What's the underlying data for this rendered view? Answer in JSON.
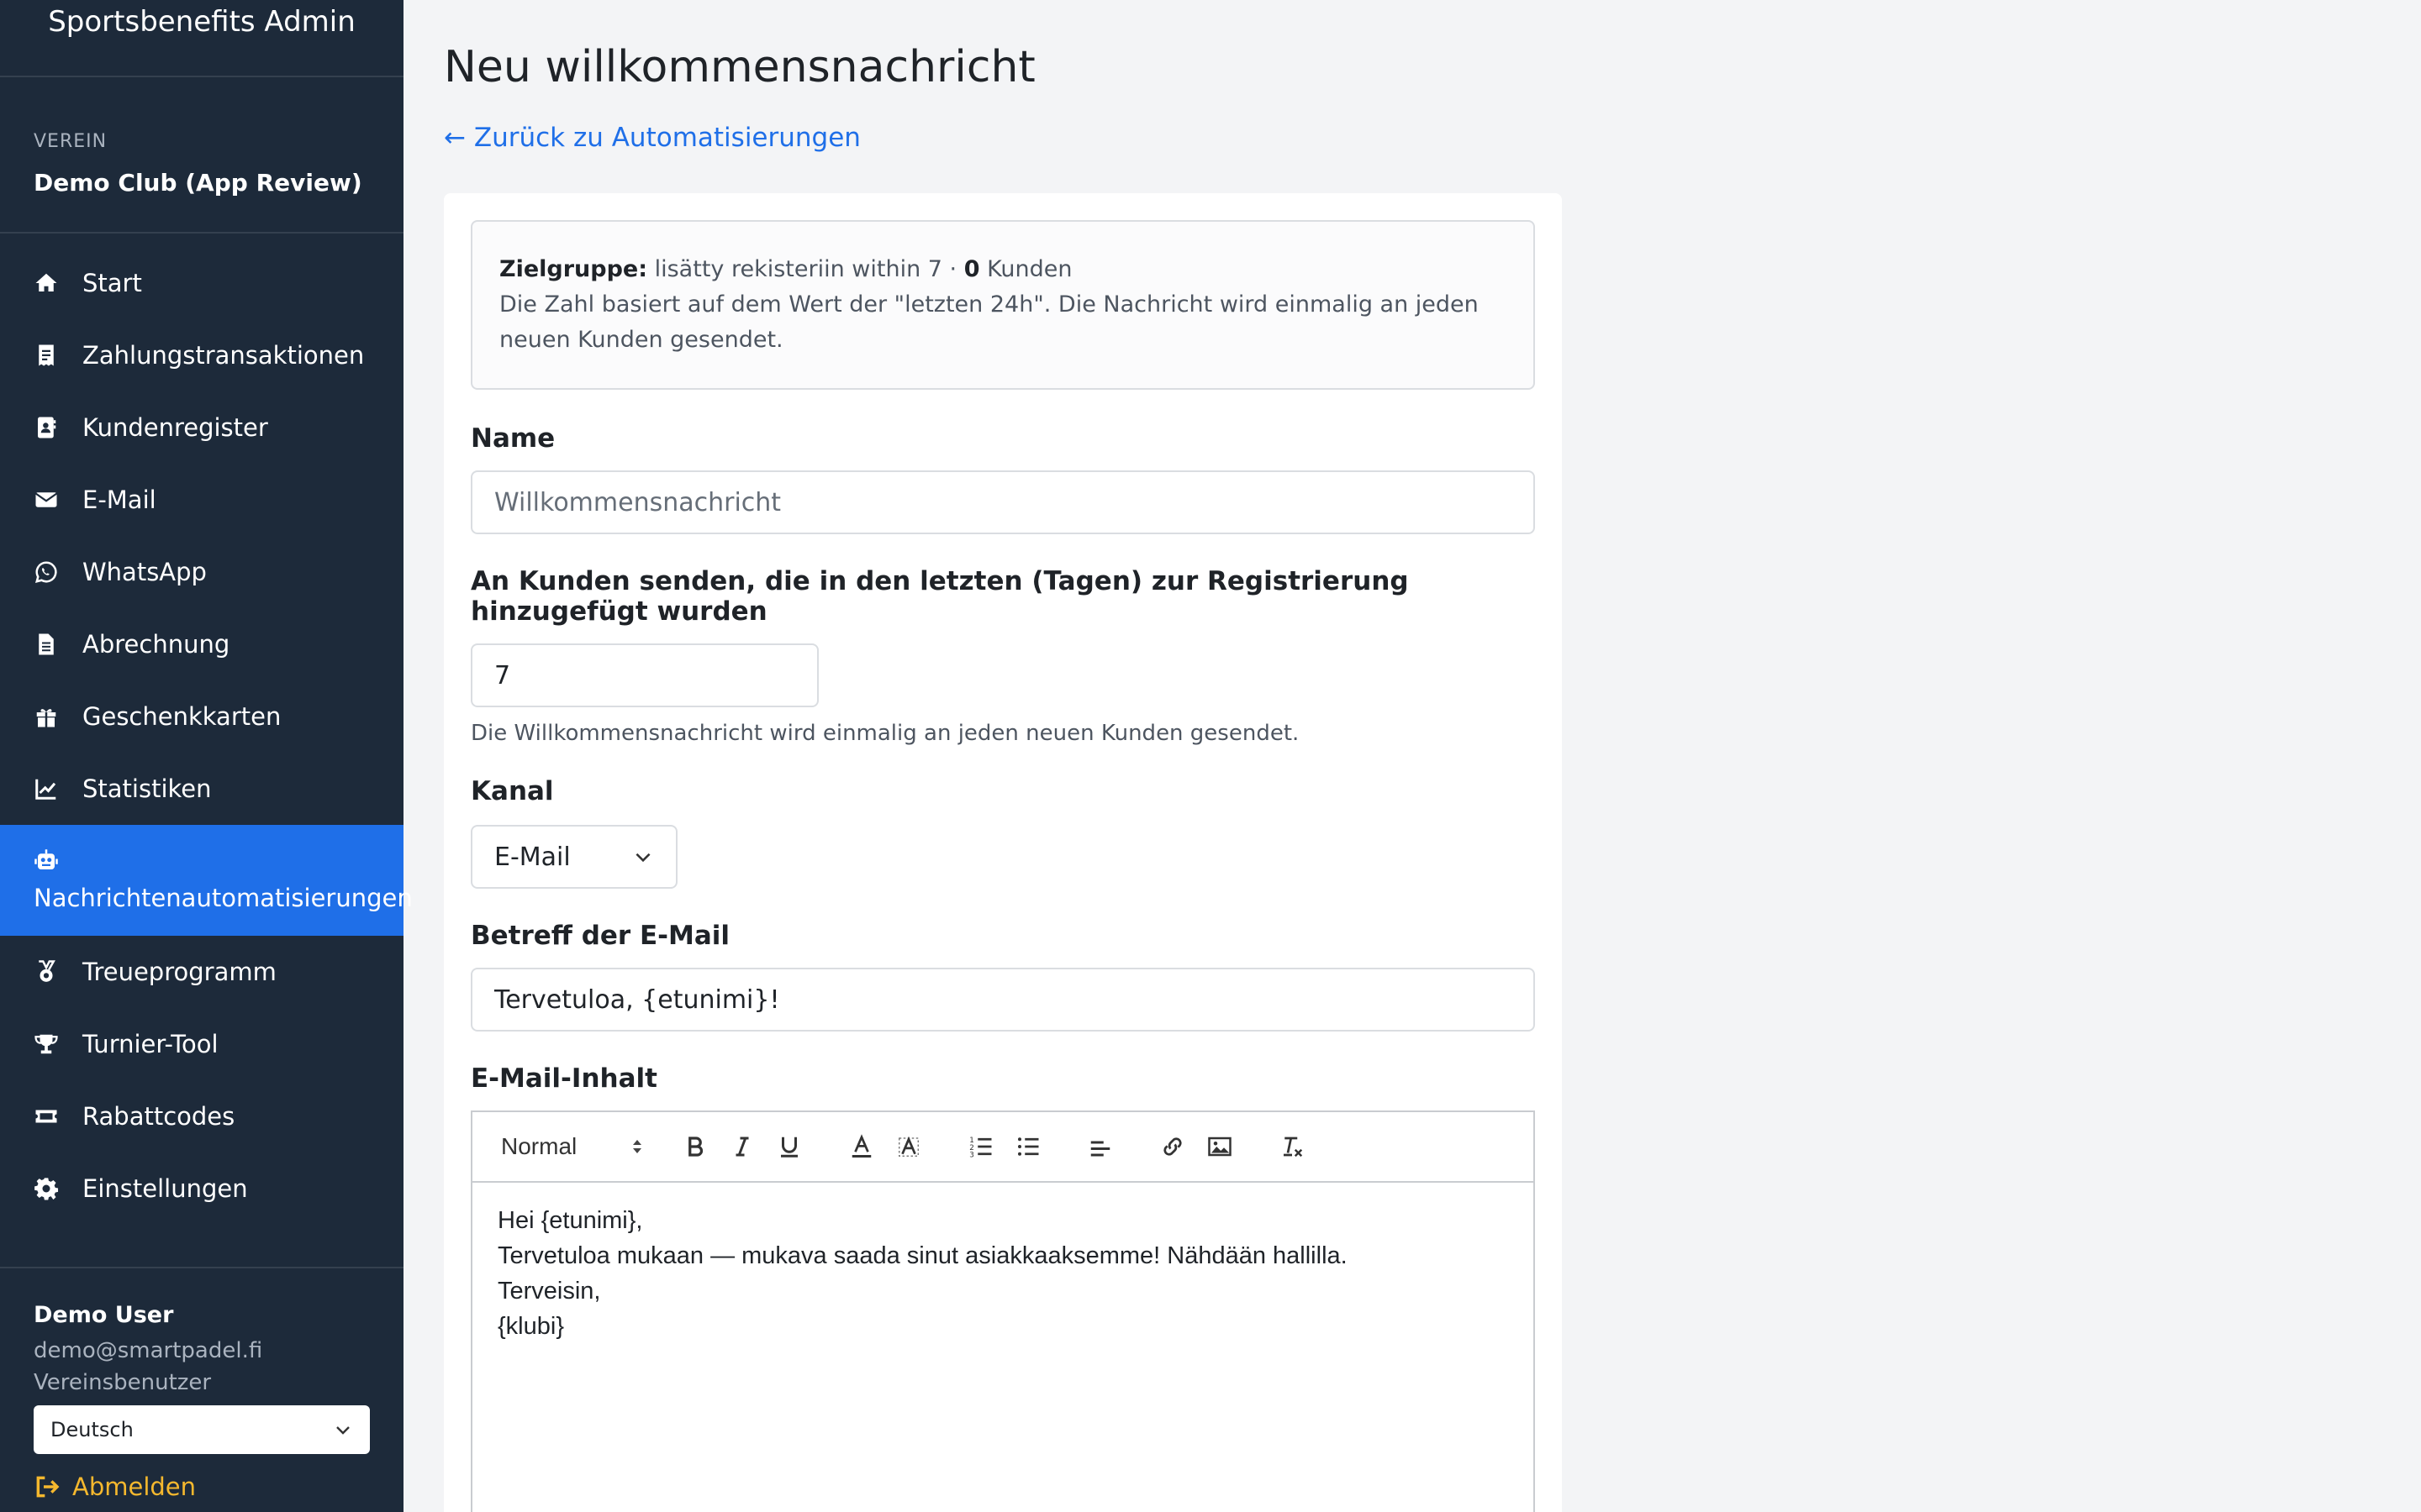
{
  "sidebar": {
    "brand": "Sportsbenefits Admin",
    "club_label": "VEREIN",
    "club_name": "Demo Club (App Review)",
    "items": [
      {
        "label": "Start",
        "icon": "home-icon"
      },
      {
        "label": "Zahlungstransaktionen",
        "icon": "receipt-icon"
      },
      {
        "label": "Kundenregister",
        "icon": "address-book-icon"
      },
      {
        "label": "E-Mail",
        "icon": "envelope-icon"
      },
      {
        "label": "WhatsApp",
        "icon": "whatsapp-icon"
      },
      {
        "label": "Abrechnung",
        "icon": "file-invoice-icon"
      },
      {
        "label": "Geschenkkarten",
        "icon": "gift-icon"
      },
      {
        "label": "Statistiken",
        "icon": "chart-line-icon"
      },
      {
        "label": "Nachrichtenautomatisierungen",
        "icon": "robot-icon",
        "active": true
      },
      {
        "label": "Treueprogramm",
        "icon": "medal-icon"
      },
      {
        "label": "Turnier-Tool",
        "icon": "trophy-icon"
      },
      {
        "label": "Rabattcodes",
        "icon": "ticket-icon"
      },
      {
        "label": "Einstellungen",
        "icon": "gear-icon"
      }
    ],
    "user": {
      "name": "Demo User",
      "email": "demo@smartpadel.fi",
      "role": "Vereinsbenutzer",
      "language": "Deutsch",
      "logout": "Abmelden"
    }
  },
  "main": {
    "title": "Neu willkommensnachricht",
    "back_link": "← Zurück zu Automatisierungen",
    "info": {
      "label": "Zielgruppe:",
      "audience": " lisätty rekisteriin within 7 · ",
      "count": "0",
      "count_suffix": " Kunden",
      "note": "Die Zahl basiert auf dem Wert der \"letzten 24h\". Die Nachricht wird einmalig an jeden neuen Kunden gesendet."
    },
    "name_label": "Name",
    "name_placeholder": "Willkommensnachricht",
    "days_label": "An Kunden senden, die in den letzten (Tagen) zur Registrierung hinzugefügt wurden",
    "days_value": "7",
    "days_hint": "Die Willkommensnachricht wird einmalig an jeden neuen Kunden gesendet.",
    "channel_label": "Kanal",
    "channel_value": "E-Mail",
    "subject_label": "Betreff der E-Mail",
    "subject_value": "Tervetuloa, {etunimi}!",
    "content_label": "E-Mail-Inhalt",
    "editor_format": "Normal",
    "editor_lines": [
      "Hei {etunimi},",
      "Tervetuloa mukaan — mukava saada sinut asiakkaaksemme! Nähdään hallilla.",
      "Terveisin,",
      "{klubi}"
    ]
  },
  "colors": {
    "sidebar_bg": "#1d2a3a",
    "accent": "#1f6fe8",
    "logout": "#f5b82e"
  }
}
